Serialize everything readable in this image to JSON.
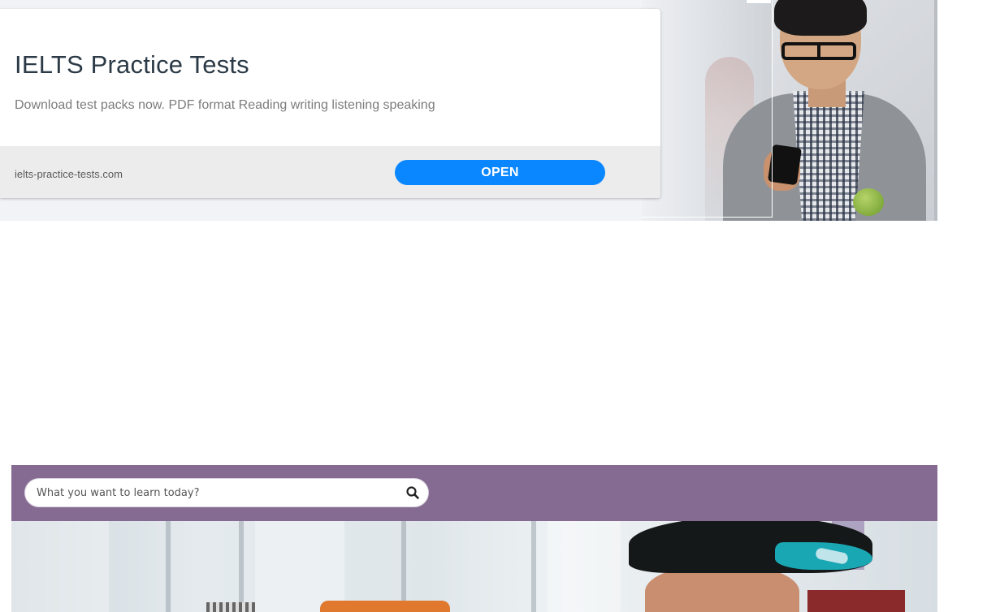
{
  "ad": {
    "title": "IELTS Practice Tests",
    "description": "Download test packs now. PDF format Reading writing listening speaking",
    "domain": "ielts-practice-tests.com",
    "open_label": "OPEN",
    "accent_color": "#0a87ff"
  },
  "search": {
    "placeholder": "What you want to learn today?",
    "value": "",
    "icon": "search-icon",
    "strip_color": "#856a91"
  }
}
